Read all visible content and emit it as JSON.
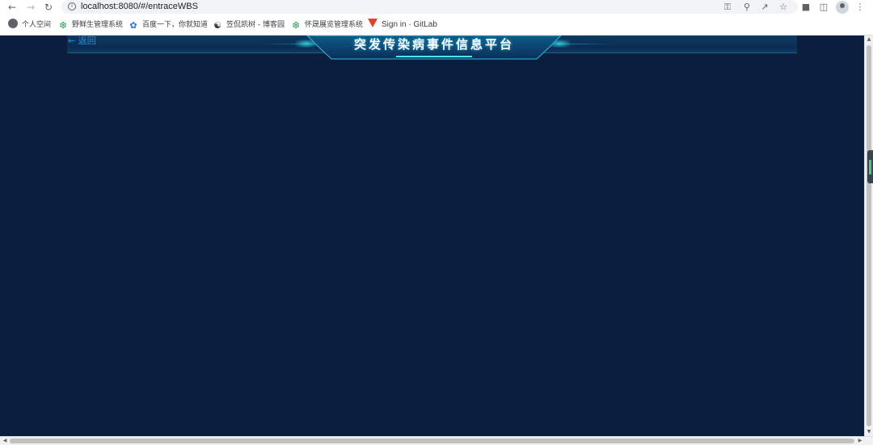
{
  "browser": {
    "url": "localhost:8080/#/entraceWBS",
    "back_icon": "arrow-left-icon",
    "forward_icon": "arrow-right-icon",
    "reload_icon": "reload-icon"
  },
  "bookmarks": [
    {
      "label": "个人空间",
      "icon": "globe-icon"
    },
    {
      "label": "野鲜生管理系统",
      "icon": "leaf-icon"
    },
    {
      "label": "百度一下，你就知道",
      "icon": "paw-icon"
    },
    {
      "label": "笠侃凯树 - 博客园",
      "icon": "blog-icon"
    },
    {
      "label": "怀晟展览管理系统",
      "icon": "leaf-icon"
    },
    {
      "label": "Sign in · GitLab",
      "icon": "gitlab-icon"
    }
  ],
  "page": {
    "back_label": "← 返回",
    "title": "突发传染病事件信息平台"
  },
  "colors": {
    "background": "#0c1e3e",
    "back_link": "#2b8fe0",
    "accent_glow": "#2fc6d8"
  }
}
